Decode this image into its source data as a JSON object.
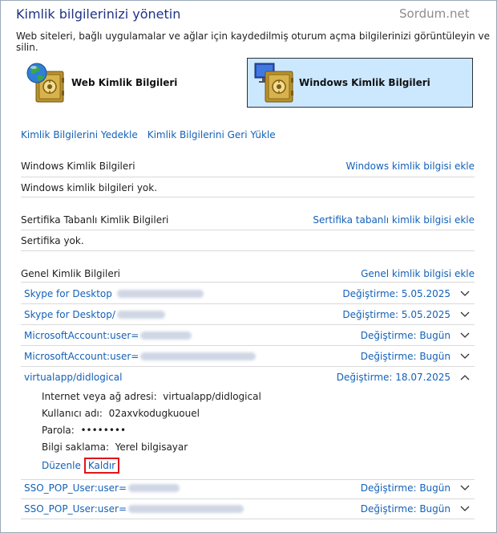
{
  "header": {
    "title": "Kimlik bilgilerinizi yönetin",
    "watermark": "Sordum.net",
    "subtitle": "Web siteleri, bağlı uygulamalar ve ağlar için kaydedilmiş oturum açma bilgilerinizi görüntüleyin ve silin."
  },
  "vaults": {
    "web_label": "Web Kimlik Bilgileri",
    "windows_label": "Windows Kimlik Bilgileri"
  },
  "top_links": {
    "backup": "Kimlik Bilgilerini Yedekle",
    "restore": "Kimlik Bilgilerini Geri Yükle"
  },
  "windows_section": {
    "title": "Windows Kimlik Bilgileri",
    "add_link": "Windows kimlik bilgisi ekle",
    "empty_text": "Windows kimlik bilgileri yok."
  },
  "cert_section": {
    "title": "Sertifika Tabanlı Kimlik Bilgileri",
    "add_link": "Sertifika tabanlı kimlik bilgisi ekle",
    "empty_text": "Sertifika yok."
  },
  "generic_section": {
    "title": "Genel Kimlik Bilgileri",
    "add_link": "Genel kimlik bilgisi ekle",
    "modified_prefix": "Değiştirme:",
    "rows": [
      {
        "name": "Skype for Desktop",
        "date": "5.05.2025",
        "expanded": false
      },
      {
        "name": "Skype for Desktop/",
        "date": "5.05.2025",
        "expanded": false
      },
      {
        "name": "MicrosoftAccount:user=",
        "date": "Bugün",
        "expanded": false
      },
      {
        "name": "MicrosoftAccount:user=",
        "date": "Bugün",
        "expanded": false
      },
      {
        "name": "virtualapp/didlogical",
        "date": "18.07.2025",
        "expanded": true
      },
      {
        "name": "SSO_POP_User:user=",
        "date": "Bugün",
        "expanded": false
      },
      {
        "name": "SSO_POP_User:user=",
        "date": "Bugün",
        "expanded": false
      }
    ],
    "details": {
      "address_label": "Internet veya ağ adresi:",
      "address_value": "virtualapp/didlogical",
      "user_label": "Kullanıcı adı:",
      "user_value": "02axvkodugkuouel",
      "password_label": "Parola:",
      "password_value": "••••••••",
      "persistence_label": "Bilgi saklama:",
      "persistence_value": "Yerel bilgisayar"
    },
    "edit_link": "Düzenle",
    "remove_link": "Kaldır"
  },
  "colors": {
    "title": "#1e3287",
    "link": "#1461b8",
    "selected_bg": "#cce8ff",
    "highlight_box": "#e0151a"
  }
}
